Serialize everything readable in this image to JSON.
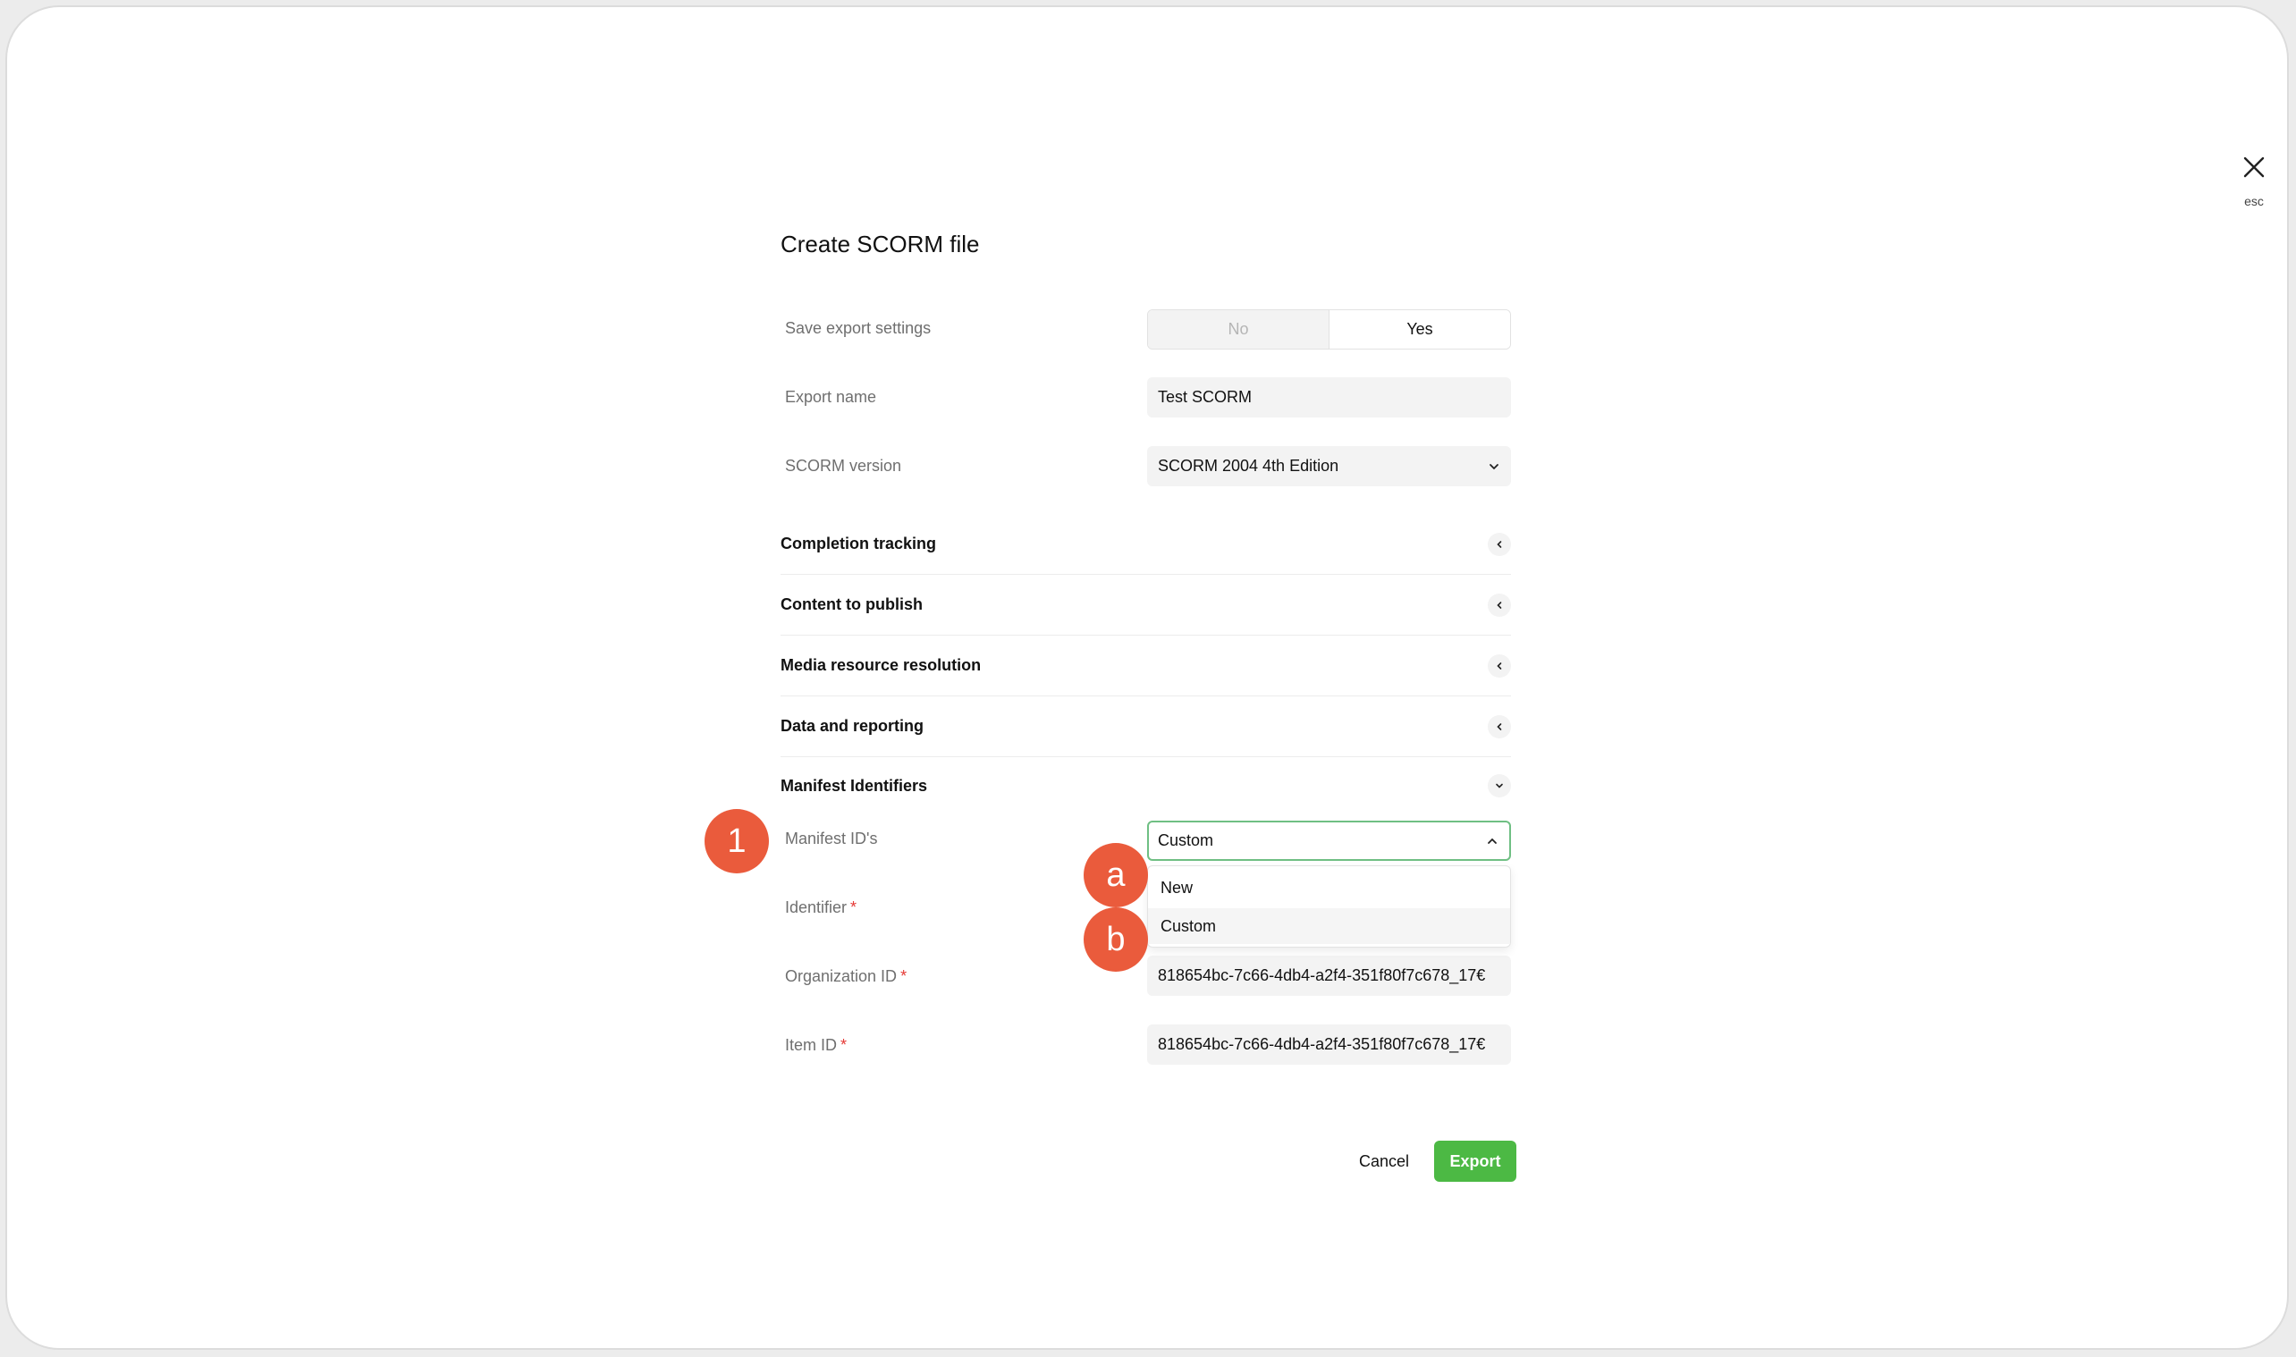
{
  "close": {
    "esc_label": "esc"
  },
  "dialog": {
    "title": "Create SCORM file",
    "save_settings": {
      "label": "Save export settings",
      "options": [
        "No",
        "Yes"
      ],
      "selected": "Yes"
    },
    "export_name": {
      "label": "Export name",
      "value": "Test SCORM"
    },
    "scorm_version": {
      "label": "SCORM version",
      "value": "SCORM 2004 4th Edition"
    },
    "sections": [
      "Completion tracking",
      "Content to publish",
      "Media resource resolution",
      "Data and reporting",
      "Manifest Identifiers"
    ],
    "manifest": {
      "ids_label": "Manifest ID's",
      "ids_value": "Custom",
      "options": [
        "New",
        "Custom"
      ],
      "identifier_label": "Identifier",
      "organization_label": "Organization ID",
      "organization_value": "818654bc-7c66-4db4-a2f4-351f80f7c678_17€",
      "item_label": "Item ID",
      "item_value": "818654bc-7c66-4db4-a2f4-351f80f7c678_17€",
      "required_mark": "*"
    },
    "buttons": {
      "cancel": "Cancel",
      "export": "Export"
    }
  },
  "annotations": {
    "step": "1",
    "option_a": "a",
    "option_b": "b"
  },
  "colors": {
    "accent_green": "#4cb944",
    "badge": "#ea5b3c",
    "focus_border": "#6fbf83"
  }
}
